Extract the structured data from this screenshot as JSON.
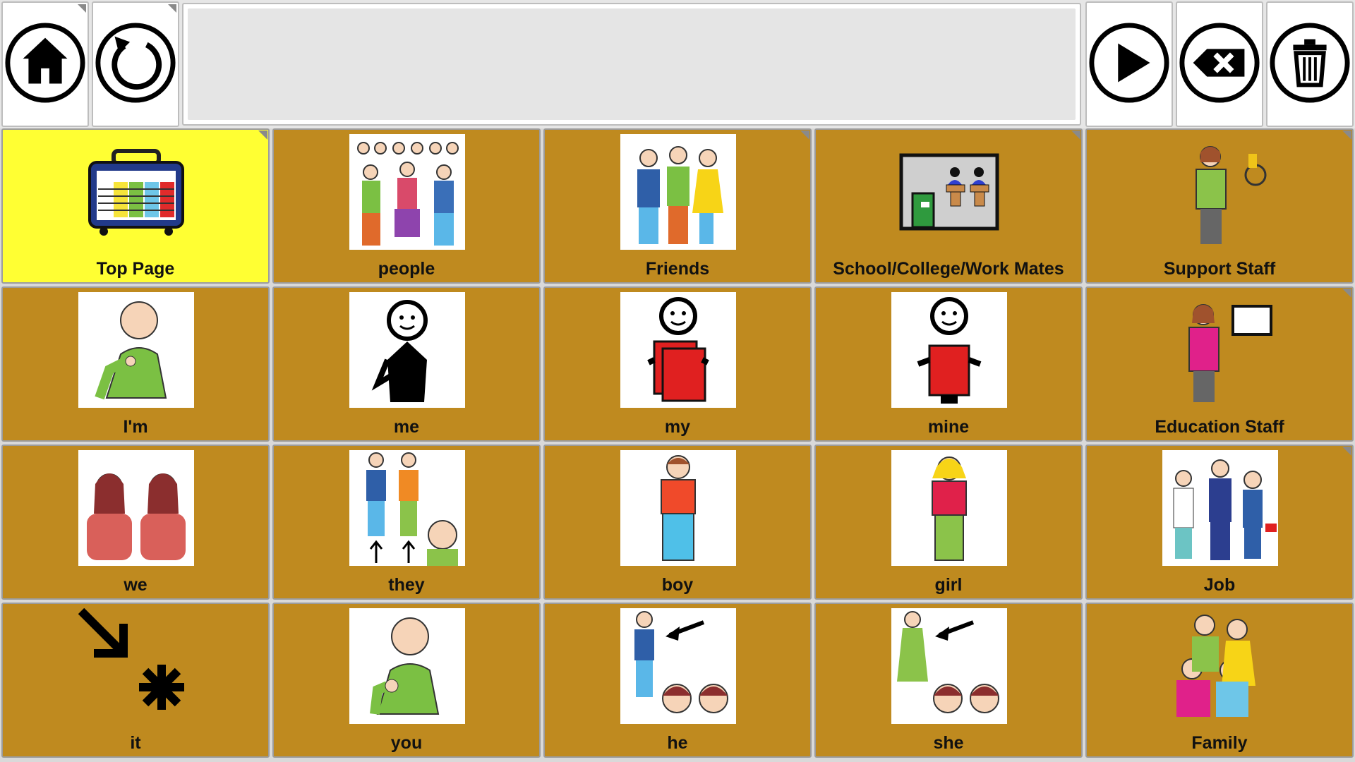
{
  "toolbar": {
    "home_icon": "home-icon",
    "undo_icon": "undo-icon",
    "play_icon": "play-icon",
    "backspace_icon": "backspace-icon",
    "clear_icon": "trash-icon"
  },
  "colors": {
    "cell": "#bf8a1f",
    "highlight": "#ffff33"
  },
  "cells": [
    {
      "label": "Top Page"
    },
    {
      "label": "people"
    },
    {
      "label": "Friends"
    },
    {
      "label": "School/College/Work Mates"
    },
    {
      "label": "Support Staff"
    },
    {
      "label": "I'm"
    },
    {
      "label": "me"
    },
    {
      "label": "my"
    },
    {
      "label": "mine"
    },
    {
      "label": "Education Staff"
    },
    {
      "label": "we"
    },
    {
      "label": "they"
    },
    {
      "label": "boy"
    },
    {
      "label": "girl"
    },
    {
      "label": "Job"
    },
    {
      "label": "it"
    },
    {
      "label": "you"
    },
    {
      "label": "he"
    },
    {
      "label": "she"
    },
    {
      "label": "Family"
    }
  ]
}
